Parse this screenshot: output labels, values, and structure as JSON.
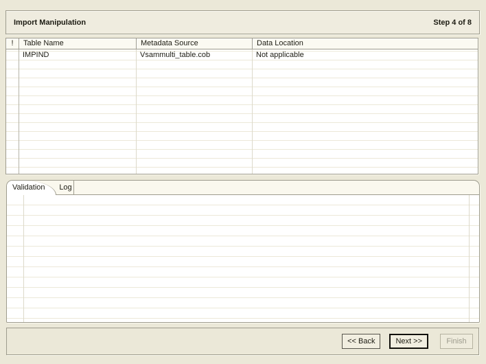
{
  "wizard": {
    "title": "Import Manipulation",
    "step_indicator": "Step 4 of 8"
  },
  "import_table": {
    "columns": [
      "!",
      "Table Name",
      "Metadata Source",
      "Data Location"
    ],
    "rows": [
      {
        "alert": "",
        "table_name": "IMPIND",
        "metadata_source": "Vsammulti_table.cob",
        "data_location": "Not applicable"
      }
    ]
  },
  "tabs": {
    "validation": "Validation",
    "log": "Log"
  },
  "buttons": {
    "back": "<< Back",
    "next": "Next >>",
    "finish": "Finish"
  },
  "colors": {
    "background": "#ebe8d8",
    "panel_border": "#9d9b8d",
    "default_button_border": "#11100b",
    "disabled_text": "#9d9b8d"
  }
}
